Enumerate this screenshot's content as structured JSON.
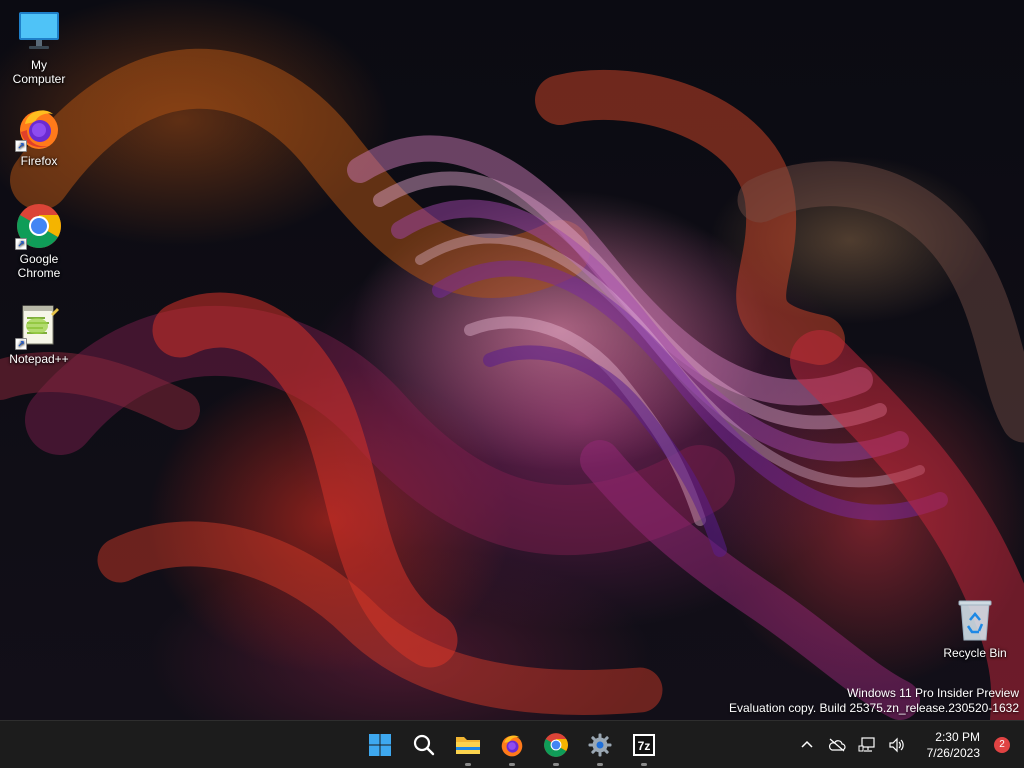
{
  "desktop": {
    "icons": [
      {
        "label": "My Computer",
        "icon": "monitor-icon"
      },
      {
        "label": "Firefox",
        "icon": "firefox-icon"
      },
      {
        "label": "Google Chrome",
        "icon": "chrome-icon"
      },
      {
        "label": "Notepad++",
        "icon": "notepadpp-icon"
      },
      {
        "label": "Recycle Bin",
        "icon": "recycle-bin-icon"
      }
    ],
    "watermark": {
      "line1": "Windows 11 Pro Insider Preview",
      "line2": "Evaluation copy. Build 25375.zn_release.230520-1632"
    }
  },
  "taskbar": {
    "pinned": [
      {
        "name": "Start",
        "icon": "windows-logo-icon",
        "running": false
      },
      {
        "name": "Search",
        "icon": "search-icon",
        "running": false
      },
      {
        "name": "File Explorer",
        "icon": "folder-icon",
        "running": true
      },
      {
        "name": "Firefox",
        "icon": "firefox-icon",
        "running": true
      },
      {
        "name": "Google Chrome",
        "icon": "chrome-icon",
        "running": true
      },
      {
        "name": "Settings",
        "icon": "gear-icon",
        "running": true
      },
      {
        "name": "7-Zip",
        "icon": "7zip-icon",
        "running": true
      }
    ],
    "tray": {
      "icons": [
        "chevron-up-icon",
        "onedrive-offline-icon",
        "network-icon",
        "volume-icon"
      ],
      "time": "2:30 PM",
      "date": "7/26/2023",
      "notification_count": "2"
    }
  },
  "colors": {
    "taskbar_bg": "#1c1c1c",
    "badge": "#e04343",
    "windows_blue": "#3ea8ef"
  }
}
